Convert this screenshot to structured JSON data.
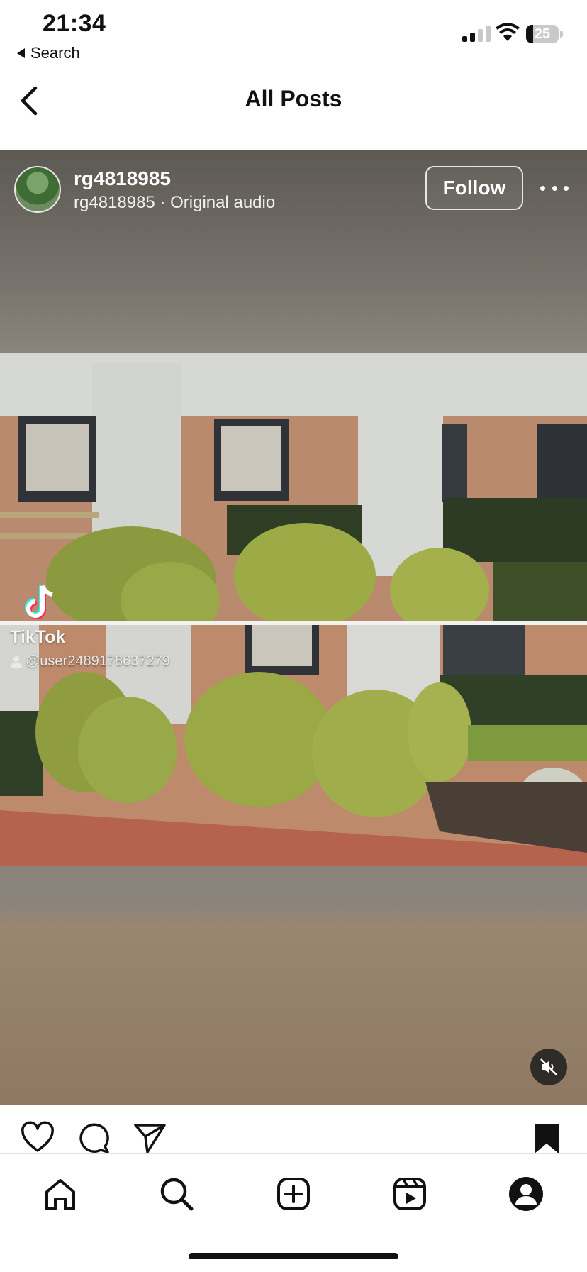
{
  "status_bar": {
    "time": "21:34",
    "back_app_label": "Search",
    "battery_level": "25",
    "signal_bars_active": 2,
    "signal_bars_total": 4
  },
  "nav": {
    "title": "All Posts",
    "back_icon": "chevron-left-icon"
  },
  "post": {
    "username": "rg4818985",
    "subtitle": "rg4818985 · Original audio",
    "follow_label": "Follow",
    "more_icon": "more-horizontal-icon",
    "watermark": {
      "brand": "TikTok",
      "user": "@user2489178637279"
    },
    "mute_icon": "muted-speaker-icon"
  },
  "actions": {
    "like_icon": "heart-icon",
    "comment_icon": "comment-icon",
    "share_icon": "send-icon",
    "save_icon": "bookmark-icon"
  },
  "tabbar": {
    "items": [
      "home-icon",
      "search-icon",
      "create-icon",
      "reels-icon",
      "profile-icon"
    ]
  },
  "colors": {
    "text": "#111111",
    "media_bg": "#8a847d",
    "brick": "#b4866a",
    "hedge": "#8a9a3c"
  }
}
